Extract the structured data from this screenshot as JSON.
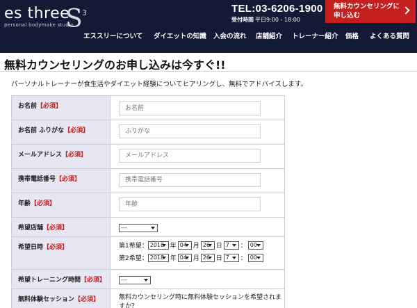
{
  "header": {
    "logo_main": "es three",
    "logo_sub": "personal bodymake studio",
    "logo_s": "S",
    "logo_3": "3",
    "tel": "TEL:03-6206-1900",
    "hours_label": "受付時間",
    "hours_value": "平日9:00 - 18:00",
    "cta_label": "無料カウンセリングに申し込む",
    "nav": [
      "エススリーについて",
      "ダイエットの知識",
      "入会の流れ",
      "店舗紹介",
      "トレーナー紹介",
      "価格",
      "よくある質問"
    ]
  },
  "page": {
    "title": "無料カウンセリングのお申し込みは今すぐ!!",
    "intro": "パーソナルトレーナーが食生活やダイエット経験についてヒアリングし、無料でアドバイスします。"
  },
  "form": {
    "required_mark": "【必須】",
    "name": {
      "label": "お名前",
      "placeholder": "お名前"
    },
    "furigana": {
      "label": "お名前 ふりがな",
      "placeholder": "ふりがな"
    },
    "email": {
      "label": "メールアドレス",
      "placeholder": "メールアドレス"
    },
    "phone": {
      "label": "携帯電話番号",
      "placeholder": "携帯電話番号"
    },
    "age": {
      "label": "年齢",
      "placeholder": "年齢"
    },
    "store": {
      "label": "希望店舗",
      "value": "---"
    },
    "datetime": {
      "label": "希望日時",
      "first_label": "第1希望：",
      "second_label": "第2希望：",
      "year": "2018",
      "month": "04",
      "day": "26",
      "hour": "7",
      "minute": "00",
      "unit_year": "年",
      "unit_month": "月",
      "unit_day": "日",
      "colon": "："
    },
    "training_time": {
      "label": "希望トレーニング時間",
      "value": "---"
    },
    "session": {
      "label": "無料体験セッション",
      "text": "無料カウンセリング時に無料体験セッションを希望されますか？"
    }
  },
  "colors": {
    "header_bg": "#131a36",
    "cta_bg": "#c51f1f",
    "label_bg": "#e6e7f2",
    "required": "#c21e1e"
  }
}
